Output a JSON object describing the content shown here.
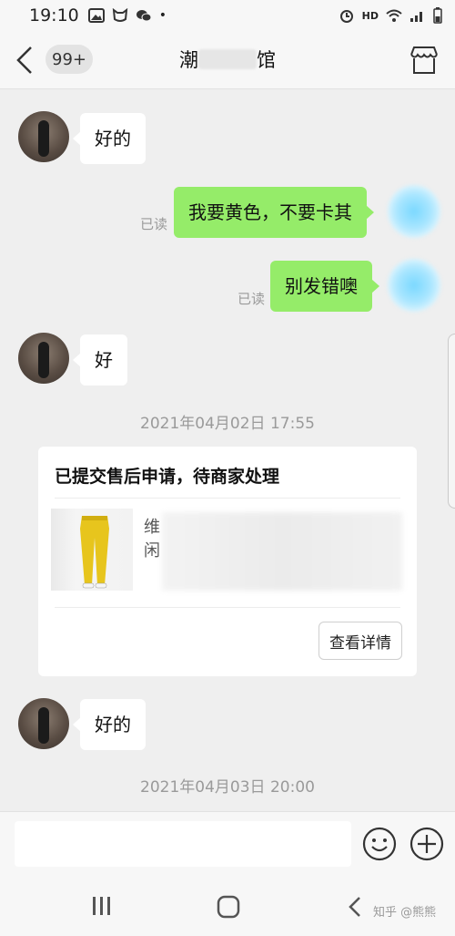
{
  "status_bar": {
    "time": "19:10",
    "network": "HD"
  },
  "header": {
    "badge": "99+",
    "title_start": "潮",
    "title_end": "馆"
  },
  "messages": [
    {
      "text": "好的"
    },
    {
      "text": "我要黄色，不要卡其",
      "status": "已读"
    },
    {
      "text": "别发错噢",
      "status": "已读"
    },
    {
      "text": "好"
    }
  ],
  "timestamp_1": "2021年04月02日 17:55",
  "order_card": {
    "title": "已提交售后申请，待商家处理",
    "product_text": "维闲",
    "button": "查看详情"
  },
  "message_after_card": {
    "text": "好的"
  },
  "timestamp_2": "2021年04月03日 20:00",
  "input": {
    "placeholder": ""
  },
  "watermark": "知乎 @熊熊",
  "colors": {
    "sent_bubble": "#95ec69",
    "received_bubble": "#ffffff",
    "background": "#efefef"
  },
  "icons": [
    "back-icon",
    "store-icon",
    "emoji-icon",
    "plus-icon",
    "recent-apps-icon",
    "home-icon",
    "nav-back-icon"
  ]
}
